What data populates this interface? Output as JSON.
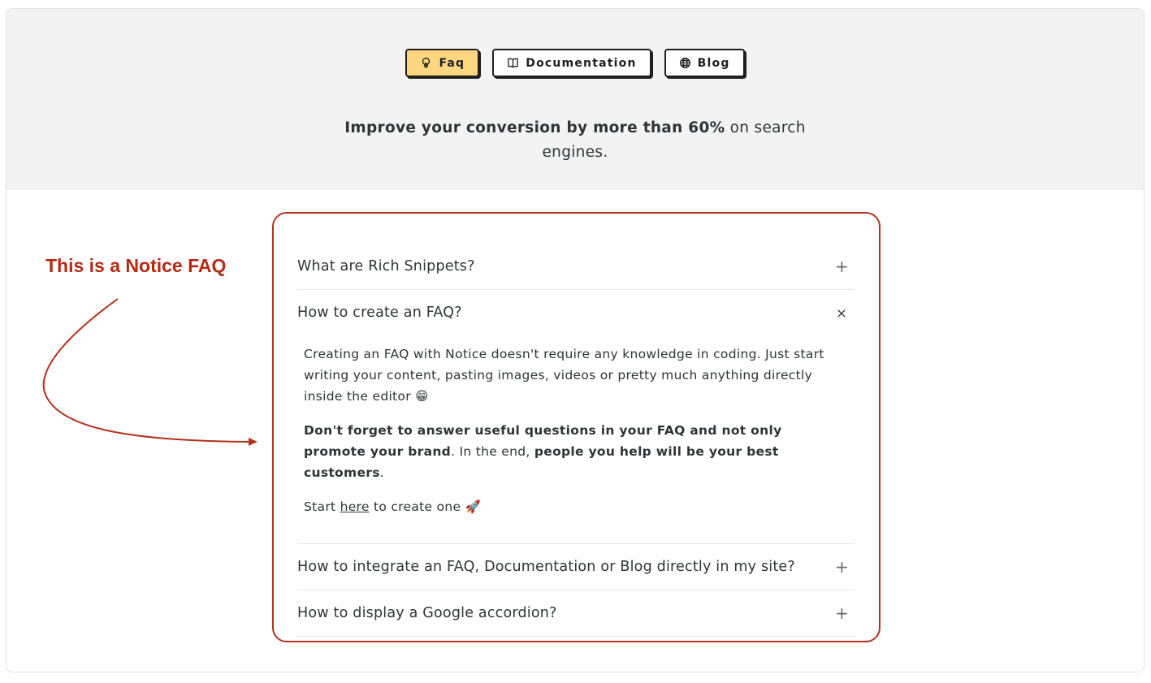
{
  "tabs": [
    {
      "label": "Faq",
      "icon": "lightbulb-icon",
      "active": true
    },
    {
      "label": "Documentation",
      "icon": "book-icon",
      "active": false
    },
    {
      "label": "Blog",
      "icon": "globe-icon",
      "active": false
    }
  ],
  "tagline": {
    "bold": "Improve your conversion by more than 60%",
    "rest": " on search engines."
  },
  "annotation": {
    "label": "This is a Notice FAQ"
  },
  "faq": {
    "items": [
      {
        "question": "What are Rich Snippets?",
        "toggle": "+"
      },
      {
        "question": "How to create an FAQ?",
        "toggle": "×",
        "answer": {
          "p1": "Creating an FAQ with Notice doesn't require any knowledge in coding. Just start writing your content, pasting images, videos or pretty much anything directly inside the editor 😁",
          "p2_bold1": "Don't forget to answer useful questions in your FAQ and not only promote your brand",
          "p2_mid": ". In the end, ",
          "p2_bold2": "people you help will be your best customers",
          "p2_end": ".",
          "p3_start": "Start ",
          "p3_link": "here",
          "p3_end": " to create one 🚀"
        }
      },
      {
        "question": "How to integrate an FAQ, Documentation or Blog directly in my site?",
        "toggle": "+"
      },
      {
        "question": "How to display a Google accordion?",
        "toggle": "+"
      }
    ]
  },
  "colors": {
    "accent_red": "#b3321d",
    "active_tab": "#fcd680",
    "hero_bg": "#f3f3f3"
  }
}
